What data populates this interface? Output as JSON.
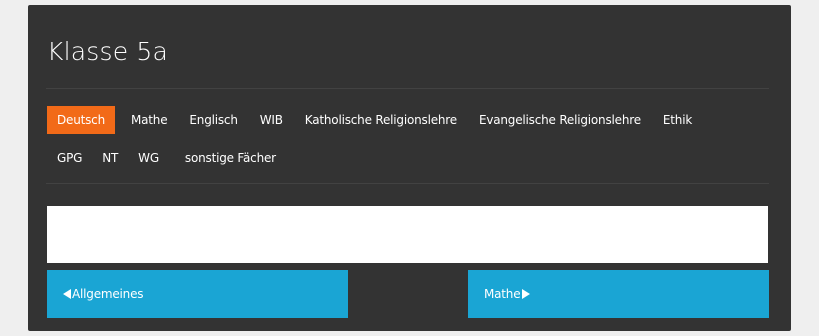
{
  "page": {
    "title": "Klasse 5a"
  },
  "tabs": {
    "row1": [
      {
        "label": "Deutsch",
        "active": true
      },
      {
        "label": "Mathe",
        "active": false
      },
      {
        "label": "Englisch",
        "active": false
      },
      {
        "label": "WIB",
        "active": false
      },
      {
        "label": "Katholische Religionslehre",
        "active": false
      },
      {
        "label": "Evangelische Religionslehre",
        "active": false
      },
      {
        "label": "Ethik",
        "active": false
      }
    ],
    "row2": [
      {
        "label": "GPG",
        "active": false
      },
      {
        "label": "NT",
        "active": false
      },
      {
        "label": "WG",
        "active": false
      },
      {
        "label": "sonstige Fächer",
        "active": false
      }
    ]
  },
  "content": {
    "text": ""
  },
  "navigation": {
    "prev_label": "Allgemeines",
    "next_label": "Mathe"
  },
  "colors": {
    "panel_background": "#333333",
    "active_tab": "#f26a18",
    "nav_button": "#1aa5d4",
    "text": "#ffffff"
  },
  "icons": {
    "prev_arrow": "triangle-left-icon",
    "next_arrow": "triangle-right-icon"
  }
}
